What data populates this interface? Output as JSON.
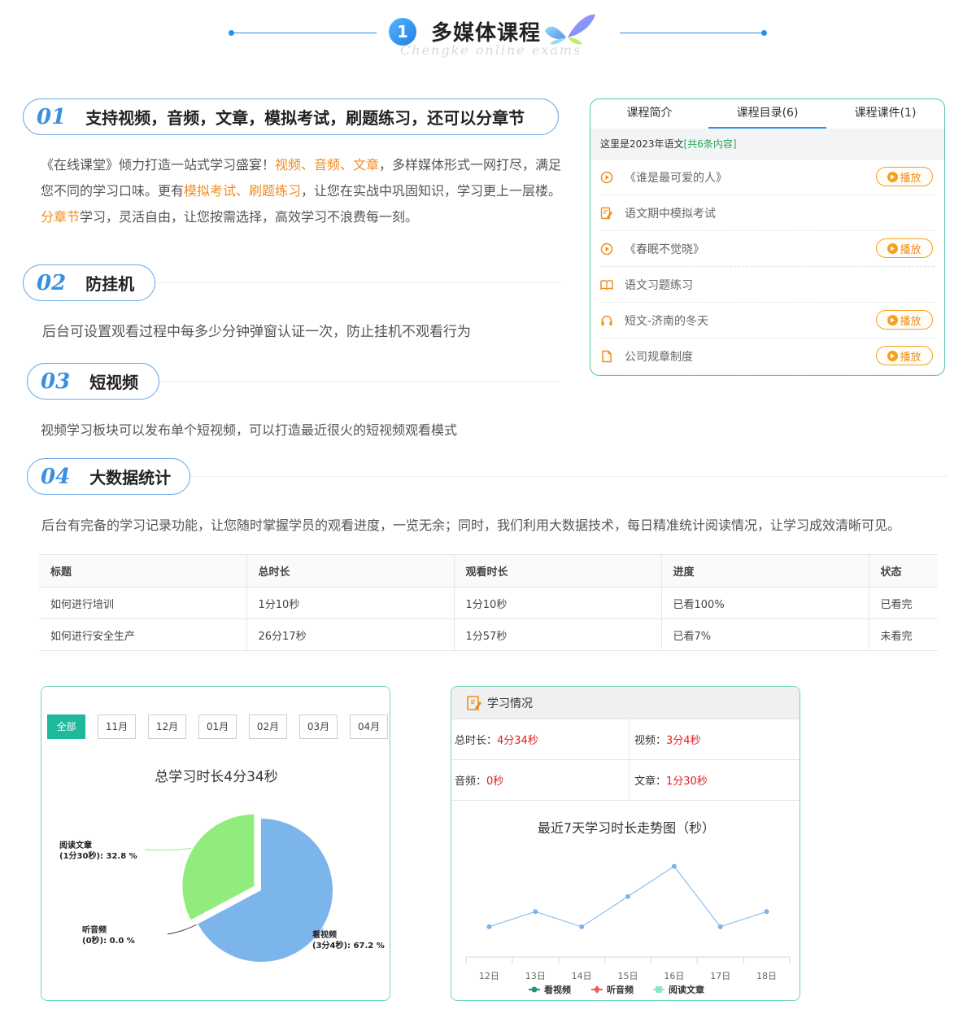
{
  "header": {
    "number": "1",
    "title": "多媒体课程",
    "subtitle": "Chengke online exams"
  },
  "sections": [
    {
      "num": "01",
      "title": "支持视频，音频，文章，模拟考试，刷题练习，还可以分章节"
    },
    {
      "num": "02",
      "title": "防挂机"
    },
    {
      "num": "03",
      "title": "短视频"
    },
    {
      "num": "04",
      "title": "大数据统计"
    }
  ],
  "section1_text": {
    "p1": "《在线课堂》倾力打造一站式学习盛宴！",
    "p1_hl": "视频、音频、文章",
    "p2": "，多样媒体形式一网打尽，满足",
    "p3": "您不同的学习口味。更有",
    "p3_hl": "模拟考试、刷题练习",
    "p4": "，让您在实战中巩固知识，学习更上一层楼。",
    "p5_hl": "分章节",
    "p5": "学习，灵活自由，让您按需选择，高效学习不浪费每一刻。"
  },
  "section2_text": "后台可设置观看过程中每多少分钟弹窗认证一次，防止挂机不观看行为",
  "section3_text": "视频学习板块可以发布单个短视频，可以打造最近很火的短视频观看模式",
  "section4_text": "后台有完备的学习记录功能，让您随时掌握学员的观看进度，一览无余；同时，我们利用大数据技术，每日精准统计阅读情况，让学习成效清晰可见。",
  "course_panel": {
    "tabs": [
      "课程简介",
      "课程目录(6)",
      "课程课件(1)"
    ],
    "info": "这里是2023年语文",
    "info_count": "[共6条内容]",
    "items": [
      {
        "icon": "play-circle-icon",
        "title": "《谁是最可爱的人》",
        "button": "播放"
      },
      {
        "icon": "exam-edit-icon",
        "title": "语文期中模拟考试",
        "button": ""
      },
      {
        "icon": "play-circle-icon",
        "title": "《春眠不觉晓》",
        "button": "播放"
      },
      {
        "icon": "book-open-icon",
        "title": "语文习题练习",
        "button": ""
      },
      {
        "icon": "headphones-icon",
        "title": "短文-济南的冬天",
        "button": "播放"
      },
      {
        "icon": "document-icon",
        "title": "公司规章制度",
        "button": "播放"
      }
    ]
  },
  "records_table": {
    "headers": [
      "标题",
      "总时长",
      "观看时长",
      "进度",
      "状态"
    ],
    "rows": [
      [
        "如何进行培训",
        "1分10秒",
        "1分10秒",
        "已看100%",
        "已看完"
      ],
      [
        "如何进行安全生产",
        "26分17秒",
        "1分57秒",
        "已看7%",
        "未看完"
      ]
    ]
  },
  "pie_card": {
    "month_tabs": [
      "全部",
      "11月",
      "12月",
      "01月",
      "02月",
      "03月",
      "04月"
    ],
    "active_tab": "全部",
    "title": "总学习时长4分34秒"
  },
  "study_card": {
    "title": "学习情况",
    "stats": [
      {
        "label": "总时长：",
        "value": "4分34秒"
      },
      {
        "label": "视频：",
        "value": "3分4秒"
      },
      {
        "label": "音频：",
        "value": "0秒"
      },
      {
        "label": "文章：",
        "value": "1分30秒"
      }
    ]
  },
  "chart_data": [
    {
      "type": "pie",
      "title": "总学习时长4分34秒",
      "slices": [
        {
          "name": "看视频",
          "label1": "看视频",
          "label2": "(3分4秒): 67.2 %",
          "value": 67.2,
          "color": "#7cb5ec"
        },
        {
          "name": "听音频",
          "label1": "听音频",
          "label2": "(0秒): 0.0 %",
          "value": 0.0,
          "color": "#434348"
        },
        {
          "name": "阅读文章",
          "label1": "阅读文章",
          "label2": "(1分30秒): 32.8 %",
          "value": 32.8,
          "color": "#90ed7d"
        }
      ]
    },
    {
      "type": "line",
      "title": "最近7天学习时长走势图（秒）",
      "categories": [
        "12日",
        "13日",
        "14日",
        "15日",
        "16日",
        "17日",
        "18日"
      ],
      "series": [
        {
          "name": "看视频",
          "color": "#2a8f7e",
          "values": [
            2,
            3,
            2,
            4,
            6,
            2,
            3
          ]
        },
        {
          "name": "听音频",
          "color": "#f15c5c",
          "values": []
        },
        {
          "name": "阅读文章",
          "color": "#8fe3d2",
          "values": []
        }
      ],
      "ylim": [
        0,
        7
      ],
      "grid": false,
      "legend": "bottom"
    }
  ]
}
